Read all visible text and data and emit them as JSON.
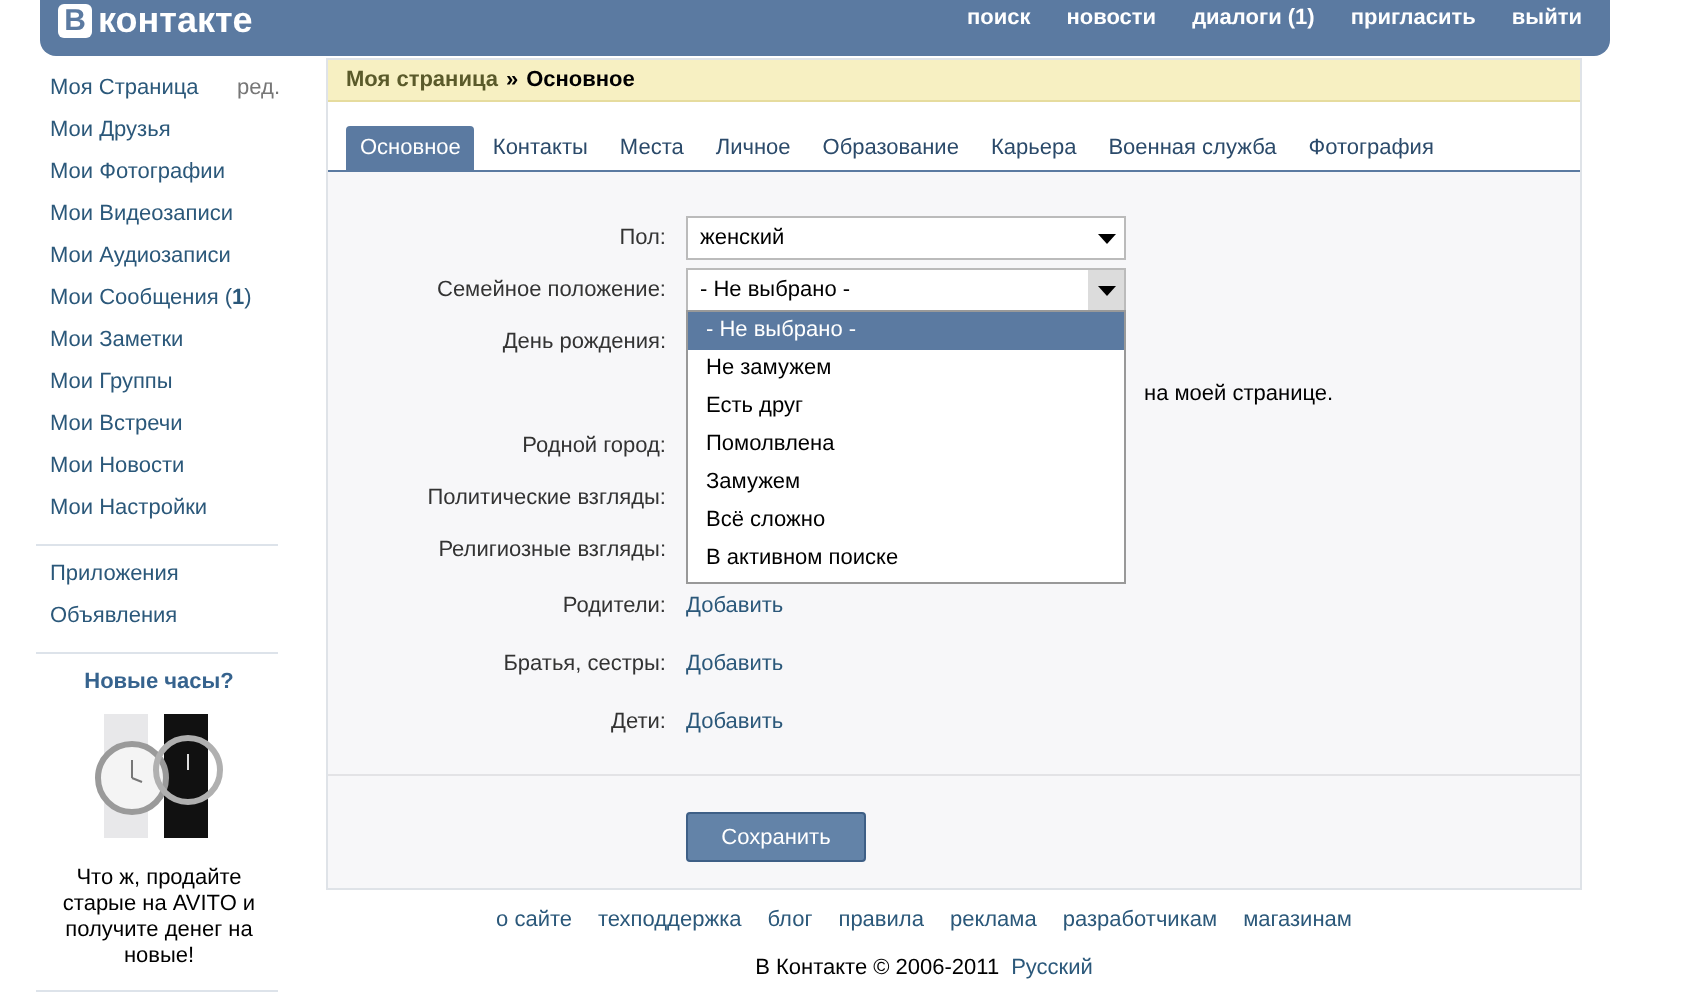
{
  "header": {
    "logo_letter": "В",
    "logo_text": "контакте",
    "nav": [
      "поиск",
      "новости",
      "диалоги (1)",
      "пригласить",
      "выйти"
    ]
  },
  "sidebar": {
    "items": [
      {
        "label": "Моя Страница",
        "edit": "ред."
      },
      {
        "label": "Мои Друзья"
      },
      {
        "label": "Мои Фотографии"
      },
      {
        "label": "Мои Видеозаписи"
      },
      {
        "label": "Мои Аудиозаписи"
      },
      {
        "label": "Мои Сообщения (**1**)"
      },
      {
        "label": "Мои Заметки"
      },
      {
        "label": "Мои Группы"
      },
      {
        "label": "Мои Встречи"
      },
      {
        "label": "Мои Новости"
      },
      {
        "label": "Мои Настройки"
      }
    ],
    "extra": [
      "Приложения",
      "Объявления"
    ],
    "ad": {
      "title": "Новые часы?",
      "text": "Что ж, продайте старые на AVITO и получите денег на новые!"
    }
  },
  "breadcrumb": {
    "parent": "Моя страница",
    "separator": "»",
    "current": "Основное"
  },
  "tabs": [
    {
      "label": "Основное",
      "selected": true
    },
    {
      "label": "Контакты",
      "selected": false
    },
    {
      "label": "Места",
      "selected": false
    },
    {
      "label": "Личное",
      "selected": false
    },
    {
      "label": "Образование",
      "selected": false
    },
    {
      "label": "Карьера",
      "selected": false
    },
    {
      "label": "Военная служба",
      "selected": false
    },
    {
      "label": "Фотография",
      "selected": false
    }
  ],
  "form": {
    "rows": [
      {
        "kind": "select",
        "label": "Пол:",
        "value": "женский",
        "open": false
      },
      {
        "kind": "select",
        "label": "Семейное положение:",
        "value": "- Не выбрано -",
        "open": true,
        "options": [
          {
            "label": "- Не выбрано -",
            "selected": true
          },
          {
            "label": "Не замужем",
            "selected": false
          },
          {
            "label": "Есть друг",
            "selected": false
          },
          {
            "label": "Помолвлена",
            "selected": false
          },
          {
            "label": "Замужем",
            "selected": false
          },
          {
            "label": "Всё сложно",
            "selected": false
          },
          {
            "label": "В активном поиске",
            "selected": false
          }
        ]
      },
      {
        "kind": "hidden",
        "label": "День рождения:"
      },
      {
        "kind": "note",
        "text": "на моей странице."
      },
      {
        "kind": "hidden",
        "label": "Родной город:"
      },
      {
        "kind": "hidden",
        "label": "Политические взгляды:"
      },
      {
        "kind": "hidden",
        "label": "Религиозные взгляды:"
      },
      {
        "kind": "link",
        "label": "Родители:",
        "link": "Добавить"
      },
      {
        "kind": "link",
        "label": "Братья, сестры:",
        "link": "Добавить"
      },
      {
        "kind": "link",
        "label": "Дети:",
        "link": "Добавить"
      }
    ],
    "save": "Сохранить"
  },
  "footer": {
    "links": [
      "о сайте",
      "техподдержка",
      "блог",
      "правила",
      "реклама",
      "разработчикам",
      "магазинам"
    ],
    "copyright": "В Контакте © 2006-2011",
    "language": "Русский"
  }
}
